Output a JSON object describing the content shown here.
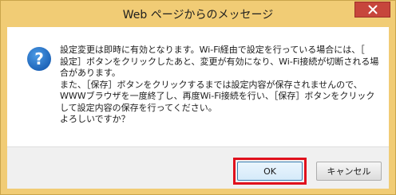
{
  "window": {
    "title": "Web ページからのメッセージ"
  },
  "dialog": {
    "icon": "info-icon",
    "message_lines": [
      "設定変更は即時に有効となります。Wi-Fi経由で設定を行っている場合には、［",
      "設定］ボタンをクリックしたあと、変更が有効になり、Wi-Fi接続が切断される場",
      "合があります。",
      "また、［保存］ボタンをクリックするまでは設定内容が保存されませんので、",
      "WWWブラウザを一度終了し、再度Wi-Fi接続を行い、［保存］ボタンをクリック",
      "して設定内容の保存を行ってください。",
      "よろしいですか？"
    ]
  },
  "buttons": {
    "ok_label": "OK",
    "cancel_label": "キャンセル"
  },
  "colors": {
    "frame": "#f1cc75",
    "close_button": "#c7463c",
    "ok_highlight": "#e0101c",
    "icon_blue": "#1f6fc5"
  }
}
